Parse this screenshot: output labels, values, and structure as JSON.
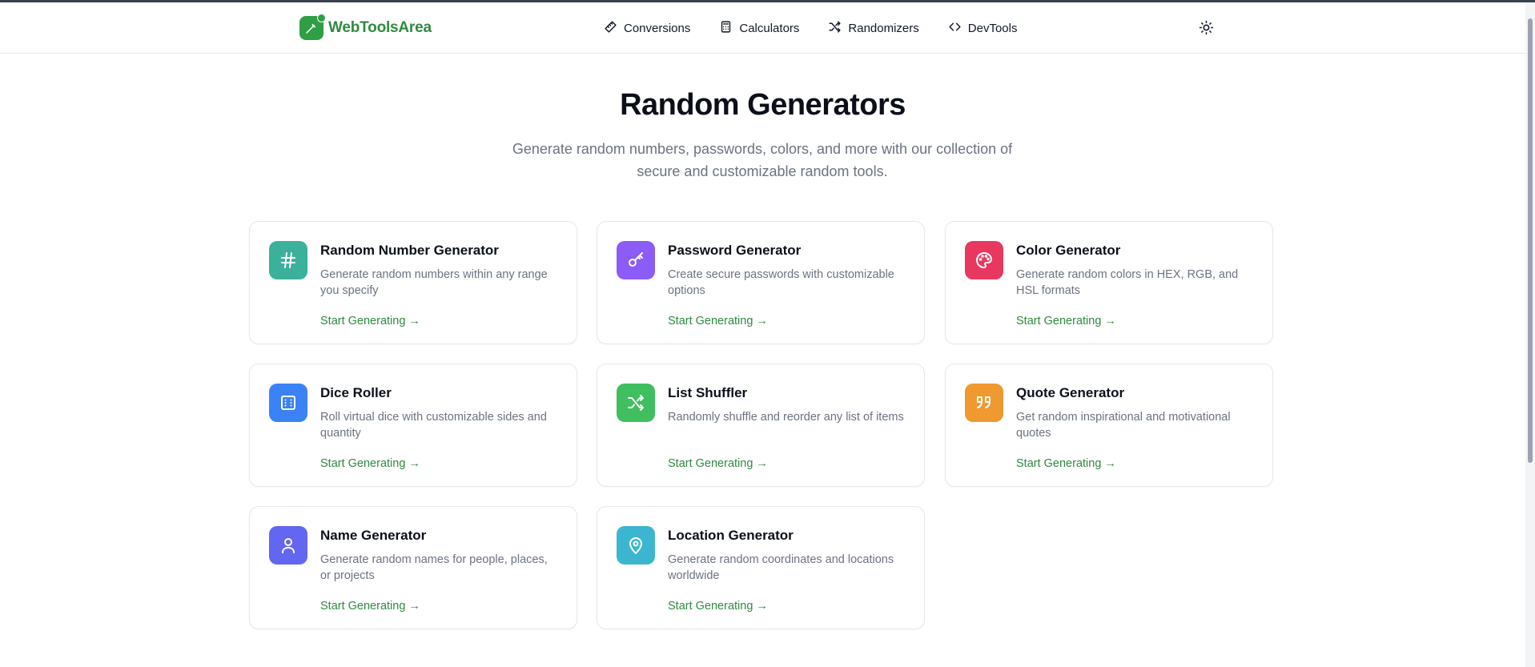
{
  "header": {
    "brand": "WebToolsArea",
    "nav": [
      {
        "label": "Conversions",
        "icon": "ruler-icon"
      },
      {
        "label": "Calculators",
        "icon": "calculator-icon"
      },
      {
        "label": "Randomizers",
        "icon": "shuffle-icon"
      },
      {
        "label": "DevTools",
        "icon": "code-icon"
      }
    ],
    "theme_icon": "sun-icon"
  },
  "main": {
    "title": "Random Generators",
    "subtitle": "Generate random numbers, passwords, colors, and more with our collection of secure and customizable random tools."
  },
  "cards": [
    {
      "title": "Random Number Generator",
      "description": "Generate random numbers within any range you specify",
      "link": "Start Generating →",
      "icon": "hash-icon",
      "color": "#3bb19b"
    },
    {
      "title": "Password Generator",
      "description": "Create secure passwords with customizable options",
      "link": "Start Generating →",
      "icon": "key-icon",
      "color": "#8b5cf6"
    },
    {
      "title": "Color Generator",
      "description": "Generate random colors in HEX, RGB, and HSL formats",
      "link": "Start Generating →",
      "icon": "palette-icon",
      "color": "#e8385f"
    },
    {
      "title": "Dice Roller",
      "description": "Roll virtual dice with customizable sides and quantity",
      "link": "Start Generating →",
      "icon": "dice-icon",
      "color": "#3b82f6"
    },
    {
      "title": "List Shuffler",
      "description": "Randomly shuffle and reorder any list of items",
      "link": "Start Generating →",
      "icon": "shuffle-icon",
      "color": "#3fbf5f"
    },
    {
      "title": "Quote Generator",
      "description": "Get random inspirational and motivational quotes",
      "link": "Start Generating →",
      "icon": "quote-icon",
      "color": "#f0992f"
    },
    {
      "title": "Name Generator",
      "description": "Generate random names for people, places, or projects",
      "link": "Start Generating →",
      "icon": "user-icon",
      "color": "#6366f1"
    },
    {
      "title": "Location Generator",
      "description": "Generate random coordinates and locations worldwide",
      "link": "Start Generating →",
      "icon": "map-pin-icon",
      "color": "#3cb6d0"
    }
  ],
  "colors": {
    "brand": "#2f9e44",
    "link": "#2f8a3e"
  }
}
